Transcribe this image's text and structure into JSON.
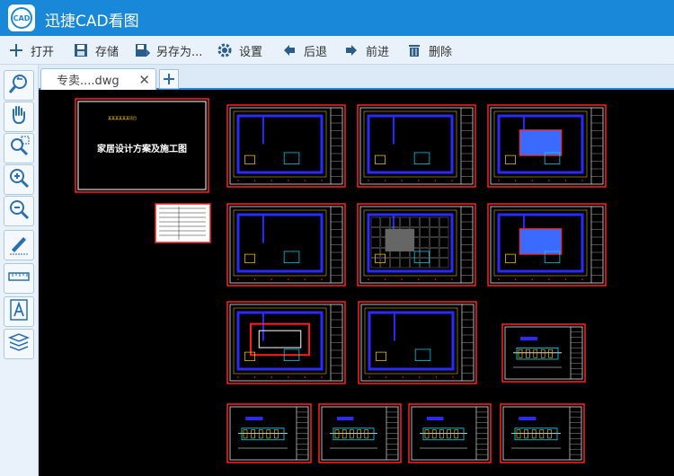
{
  "app": {
    "title": "迅捷CAD看图",
    "logo_text": "CAD"
  },
  "toolbar": {
    "open": "打开",
    "save": "存储",
    "save_as": "另存为...",
    "settings": "设置",
    "back": "后退",
    "forward": "前进",
    "delete": "删除"
  },
  "sidebar": {
    "tools": [
      "undo-view",
      "pan",
      "zoom-window",
      "zoom-in",
      "zoom-out",
      "measure",
      "ruler",
      "text",
      "layers"
    ]
  },
  "tabs": [
    {
      "label": "专卖....dwg",
      "close": "✕"
    }
  ],
  "tab_add": "+",
  "drawing": {
    "cover_title": "家居设计方案及施工图",
    "cover_subtitle": "某某某某某某项目"
  },
  "colors": {
    "title_bar": "#1a88d8",
    "toolbar": "#e9f2fa",
    "canvas": "#000000",
    "sheet_border": "#ff2020"
  }
}
